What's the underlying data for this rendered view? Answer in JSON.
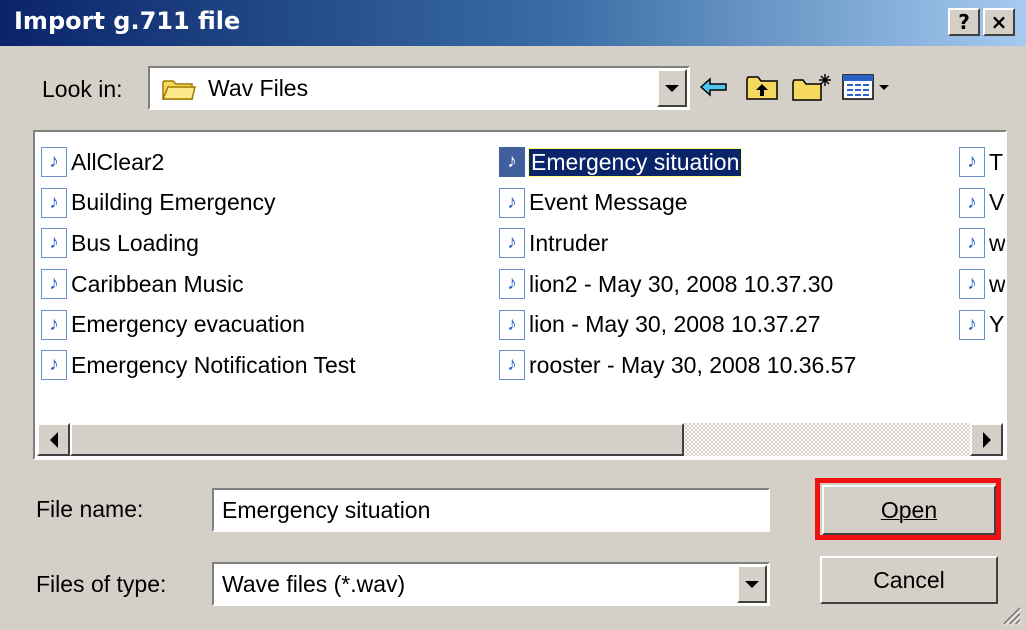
{
  "window": {
    "title": "Import g.711 file",
    "help_label": "?",
    "close_label": "×"
  },
  "look_in": {
    "label": "Look in:",
    "value": "Wav Files",
    "icon": "folder-icon"
  },
  "toolbar": {
    "icons": [
      "back-arrow-icon",
      "up-folder-icon",
      "new-folder-icon",
      "view-menu-icon"
    ]
  },
  "files": {
    "columns": [
      [
        "AllClear2",
        "Building Emergency",
        "Bus Loading",
        "Caribbean Music",
        "Emergency evacuation",
        "Emergency Notification Test"
      ],
      [
        "Emergency situation",
        "Event Message",
        "Intruder",
        "lion2 - May 30, 2008 10.37.30",
        "lion - May 30, 2008 10.37.27",
        "rooster - May 30, 2008 10.36.57"
      ],
      [
        "T",
        "V",
        "w",
        "w",
        "Y"
      ]
    ],
    "selected": "Emergency situation",
    "icon": "audio-file-icon"
  },
  "file_name": {
    "label": "File name:",
    "value": "Emergency situation"
  },
  "file_type": {
    "label": "Files of type:",
    "value": "Wave files (*.wav)"
  },
  "buttons": {
    "open": "Open",
    "cancel": "Cancel"
  },
  "colors": {
    "title_bar_start": "#0a246a",
    "title_bar_end": "#a6caf0",
    "highlight_border": "#ee1111",
    "selection": "#0a246a"
  }
}
